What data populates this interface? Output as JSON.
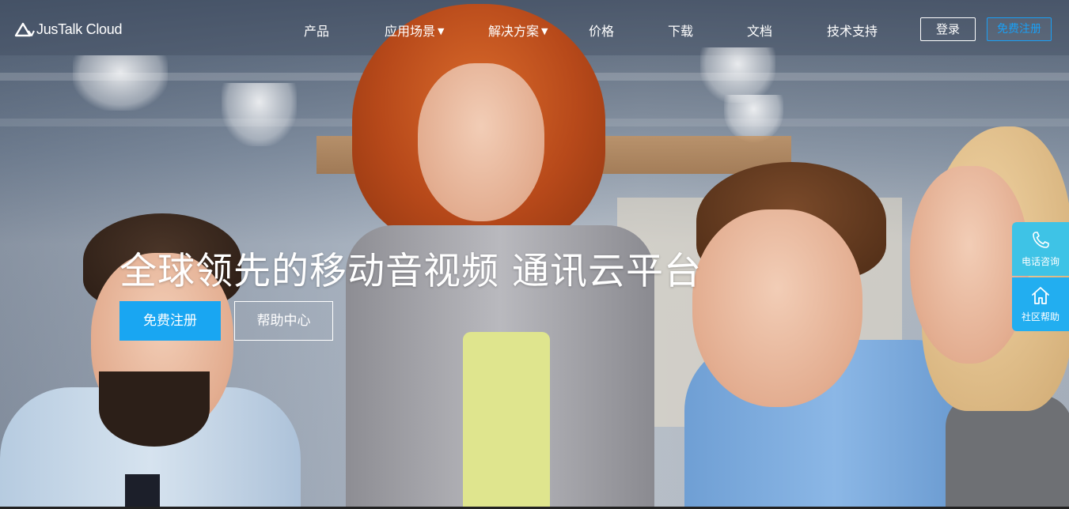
{
  "nav": {
    "logo_text": "JusTalk Cloud",
    "items": [
      {
        "label": "产品",
        "dropdown": false
      },
      {
        "label": "应用场景",
        "dropdown": true
      },
      {
        "label": "解决方案",
        "dropdown": true
      },
      {
        "label": "价格",
        "dropdown": false
      },
      {
        "label": "下载",
        "dropdown": false
      },
      {
        "label": "文档",
        "dropdown": false
      },
      {
        "label": "技术支持",
        "dropdown": false
      }
    ],
    "caret": "▼",
    "login_label": "登录",
    "register_label": "免费注册"
  },
  "hero": {
    "headline": "全球领先的移动音视频 通讯云平台",
    "cta_label": "免费注册",
    "help_label": "帮助中心"
  },
  "float_panel": {
    "phone_label": "电话咨询",
    "community_label": "社区帮助"
  },
  "colors": {
    "accent": "#19a6f2",
    "float_top": "#3ec3e6",
    "float_bottom": "#22aef0"
  },
  "icons": {
    "logo": "justalk-logo-icon",
    "phone": "phone-icon",
    "home": "home-icon",
    "caret": "caret-down-icon"
  }
}
